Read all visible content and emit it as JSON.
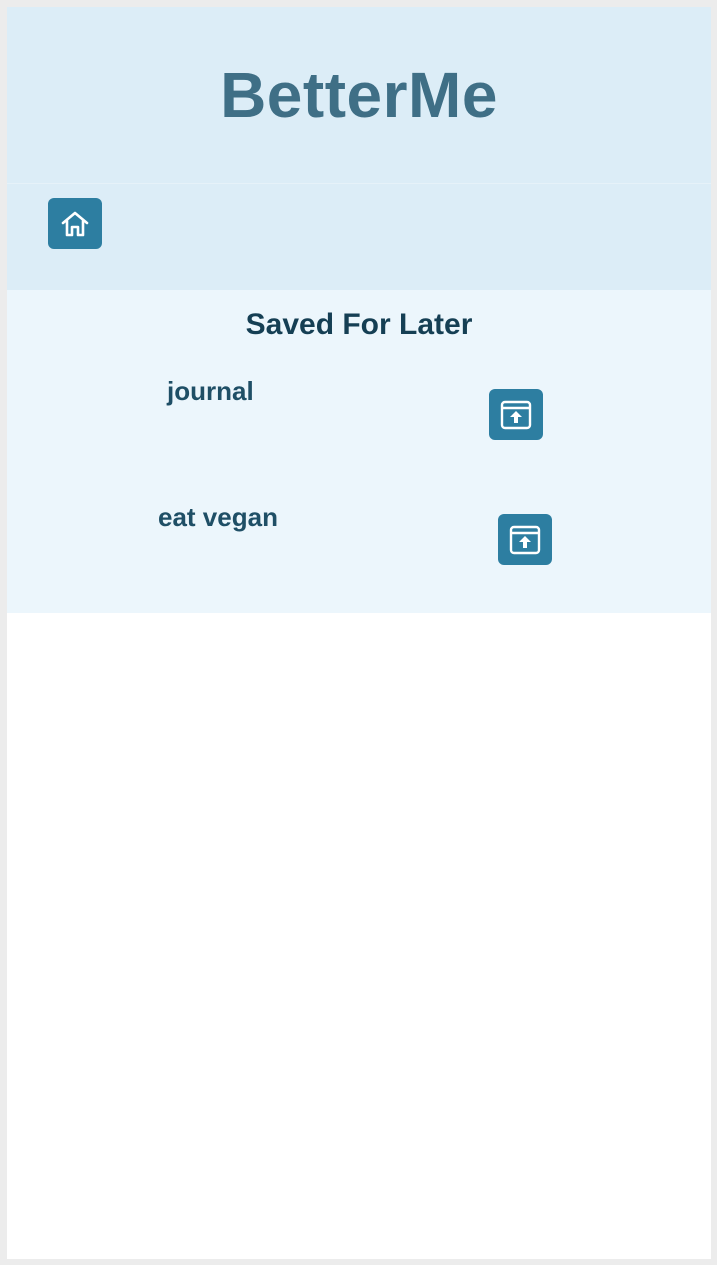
{
  "app": {
    "title": "BetterMe"
  },
  "nav": {
    "home_icon": "home-icon"
  },
  "saved": {
    "title": "Saved For Later",
    "items": [
      {
        "label": "journal",
        "action_icon": "unarchive-icon"
      },
      {
        "label": "eat vegan",
        "action_icon": "unarchive-icon"
      }
    ]
  },
  "colors": {
    "header_bg": "#dcedf7",
    "section_bg": "#ecf6fc",
    "button_bg": "#2d7ea1",
    "title_color": "#3f6f86",
    "text_dark": "#153f54"
  }
}
